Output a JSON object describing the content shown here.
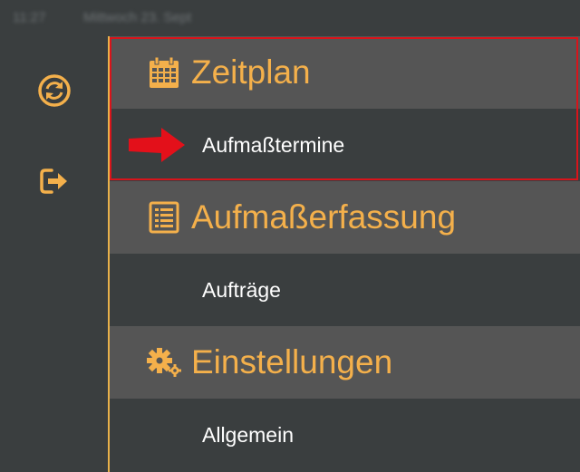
{
  "statusbar": {
    "time": "11:27",
    "date": "Mittwoch 23. Sept"
  },
  "rail": {
    "buttons": [
      {
        "icon": "sync-icon"
      },
      {
        "icon": "logout-icon"
      }
    ]
  },
  "colors": {
    "accent": "#f4b04b",
    "header_bg": "#555555",
    "bg": "#3a3e3f",
    "highlight": "#d8141b"
  },
  "sections": [
    {
      "title": "Zeitplan",
      "icon": "calendar-icon",
      "items": [
        {
          "label": "Aufmaßtermine"
        }
      ]
    },
    {
      "title": "Aufmaßerfassung",
      "icon": "list-icon",
      "items": [
        {
          "label": "Aufträge"
        }
      ]
    },
    {
      "title": "Einstellungen",
      "icon": "gears-icon",
      "items": [
        {
          "label": "Allgemein"
        }
      ]
    }
  ]
}
